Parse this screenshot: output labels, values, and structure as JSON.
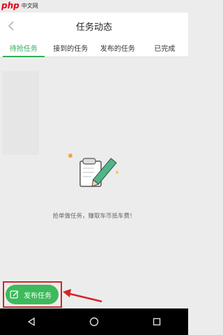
{
  "watermark": {
    "brand": "php",
    "site_text": "中文网"
  },
  "header": {
    "title": "任务动态"
  },
  "tabs": [
    {
      "label": "待抢任务",
      "active": true
    },
    {
      "label": "接到的任务",
      "active": false
    },
    {
      "label": "发布的任务",
      "active": false
    },
    {
      "label": "已完成",
      "active": false
    }
  ],
  "empty_state": {
    "message": "抢单做任务，赚取车币抵车费！"
  },
  "publish": {
    "label": "发布任务"
  },
  "colors": {
    "accent": "#2fae56",
    "button": "#3cba5c",
    "highlight": "#d42428"
  },
  "icons": {
    "back": "chevron-left-icon",
    "publish": "edit-icon",
    "nav_back": "triangle-back-icon",
    "nav_home": "circle-home-icon",
    "nav_recent": "square-recent-icon"
  }
}
